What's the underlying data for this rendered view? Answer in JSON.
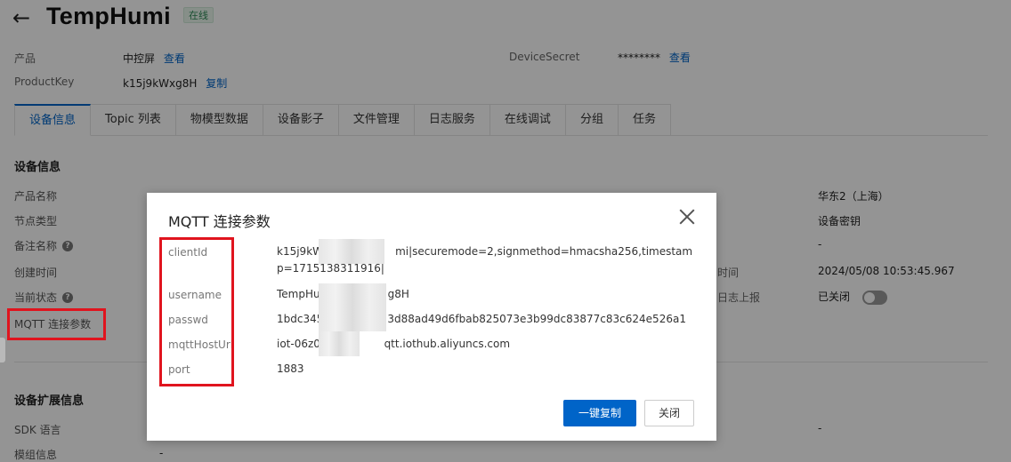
{
  "header": {
    "back_icon": "arrow-left-icon",
    "title": "TempHumi",
    "status": "在线"
  },
  "meta": {
    "product_label": "产品",
    "product_value": "中控屏",
    "product_link": "查看",
    "productkey_label": "ProductKey",
    "productkey_value": "k15j9kWxg8H",
    "productkey_link": "复制",
    "secret_label": "DeviceSecret",
    "secret_value": "********",
    "secret_link": "查看"
  },
  "tabs": [
    {
      "label": "设备信息",
      "active": true
    },
    {
      "label": "Topic 列表",
      "active": false
    },
    {
      "label": "物模型数据",
      "active": false
    },
    {
      "label": "设备影子",
      "active": false
    },
    {
      "label": "文件管理",
      "active": false
    },
    {
      "label": "日志服务",
      "active": false
    },
    {
      "label": "在线调试",
      "active": false
    },
    {
      "label": "分组",
      "active": false
    },
    {
      "label": "任务",
      "active": false
    }
  ],
  "device_info": {
    "section_title": "设备信息",
    "rows": [
      {
        "label": "产品名称",
        "help": false
      },
      {
        "label": "节点类型",
        "help": false
      },
      {
        "label": "备注名称",
        "help": true
      },
      {
        "label": "创建时间",
        "help": false
      },
      {
        "label": "当前状态",
        "help": true
      },
      {
        "label": "MQTT 连接参数",
        "help": false
      }
    ],
    "right_col": {
      "region": "华东2（上海）",
      "auth_type": "设备密钥",
      "remark": "-",
      "time_label_fragment": "时间",
      "time_value": "2024/05/08 10:53:45.967",
      "log_label_fragment": "日志上报",
      "log_value": "已关闭"
    }
  },
  "ext_info": {
    "section_title": "设备扩展信息",
    "rows": [
      {
        "label": "SDK 语言",
        "value": "-"
      },
      {
        "label": "模组信息",
        "value": "-"
      }
    ],
    "right_value": "-"
  },
  "modal": {
    "title": "MQTT 连接参数",
    "close_icon": "close-icon",
    "params": [
      {
        "label": "clientId",
        "value_prefix": "k15j9kWx",
        "value_suffix": "mi|securemode=2,signmethod=hmacsha256,timestamp=1715138311916|"
      },
      {
        "label": "username",
        "value_prefix": "TempHu",
        "value_suffix": "g8H"
      },
      {
        "label": "passwd",
        "value_prefix": "1bdc345",
        "value_suffix": "3d88ad49d6fbab825073e3b99dc83877c83c624e526a1"
      },
      {
        "label": "mqttHostUrl",
        "value_prefix": "iot-06z00",
        "value_suffix": "qtt.iothub.aliyuncs.com"
      },
      {
        "label": "port",
        "value_prefix": "1883",
        "value_suffix": ""
      }
    ],
    "copy_button": "一键复制",
    "close_button": "关闭"
  },
  "colors": {
    "accent": "#0064c8",
    "highlight": "#e0141e",
    "online": "#2e8b57"
  }
}
